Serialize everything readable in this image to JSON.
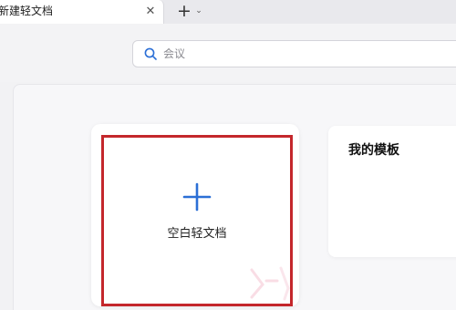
{
  "tab": {
    "title": "新建轻文档",
    "close_glyph": "✕"
  },
  "new_tab": {
    "plus_glyph": "+",
    "dropdown_glyph": "⌄"
  },
  "search": {
    "placeholder": "会议",
    "value": "",
    "icon": "search-icon"
  },
  "blank_doc": {
    "label": "空白轻文档",
    "icon": "plus-icon",
    "accent_color": "#2b6fd6",
    "highlight_color": "#c4272c"
  },
  "templates": {
    "title": "我的模板"
  }
}
